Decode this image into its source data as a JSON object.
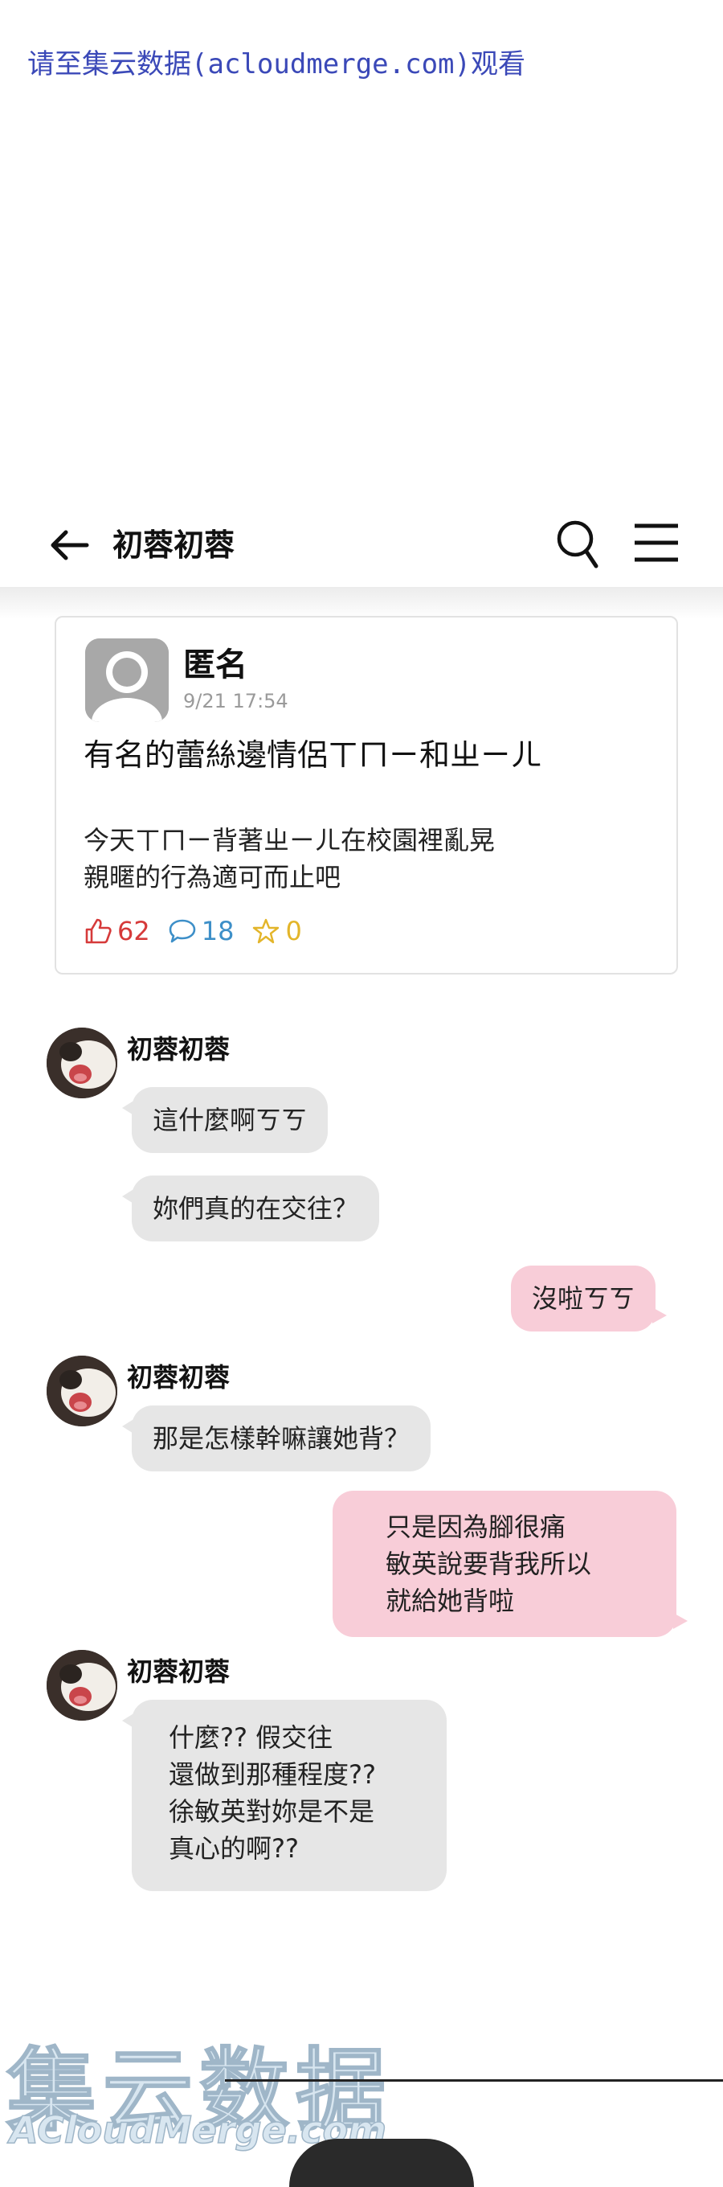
{
  "top_note": "请至集云数据(acloudmerge.com)观看",
  "header": {
    "title": "初蓉初蓉"
  },
  "post": {
    "author": "匿名",
    "time": "9/21 17:54",
    "title": "有名的蕾絲邊情侶ㄒㄇㄧ和ㄓㄧㄦ",
    "body_line1": "今天ㄒㄇㄧ背著ㄓㄧㄦ在校園裡亂晃",
    "body_line2": "親暱的行為適可而止吧",
    "likes": "62",
    "comments": "18",
    "stars": "0"
  },
  "chat": [
    {
      "sender": "初蓉初蓉",
      "messages": [
        "這什麼啊ㄎㄎ",
        "妳們真的在交往？"
      ]
    },
    {
      "sender": "me",
      "messages": [
        "沒啦ㄎㄎ"
      ]
    },
    {
      "sender": "初蓉初蓉",
      "messages": [
        "那是怎樣幹嘛讓她背？"
      ]
    },
    {
      "sender": "me",
      "messages": [
        "只是因為腳很痛\n敏英說要背我所以\n就給她背啦"
      ]
    },
    {
      "sender": "初蓉初蓉",
      "messages": [
        "什麼?? 假交往\n還做到那種程度??\n徐敏英對妳是不是\n真心的啊??"
      ]
    }
  ],
  "watermark": {
    "cn": "集云数据",
    "en": "ACloudMerge.com"
  },
  "colors": {
    "out_bubble": "#f8cdd8",
    "in_bubble": "#e6e6e6",
    "like": "#d63a3a",
    "comment": "#3d8fc8",
    "star": "#e3b52a"
  }
}
